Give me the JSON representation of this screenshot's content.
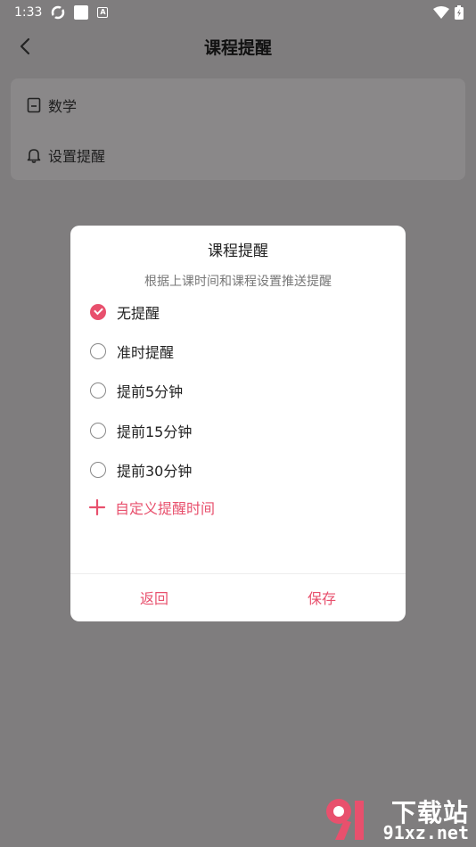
{
  "status_bar": {
    "time": "1:33",
    "a_label": "A",
    "icons": [
      "settings-sync-icon",
      "square-icon",
      "a-icon",
      "wifi-icon",
      "battery-icon"
    ]
  },
  "app_bar": {
    "title": "课程提醒"
  },
  "info_card": {
    "course_name": "数学",
    "reminder_label": "设置提醒"
  },
  "dialog": {
    "title": "课程提醒",
    "subtitle": "根据上课时间和课程设置推送提醒",
    "options": [
      {
        "label": "无提醒",
        "checked": true
      },
      {
        "label": "准时提醒",
        "checked": false
      },
      {
        "label": "提前5分钟",
        "checked": false
      },
      {
        "label": "提前15分钟",
        "checked": false
      },
      {
        "label": "提前30分钟",
        "checked": false
      }
    ],
    "custom_label": "自定义提醒时间",
    "back_label": "返回",
    "save_label": "保存"
  },
  "watermark": {
    "text": "下载站",
    "url": "91xz.net"
  },
  "colors": {
    "accent": "#e8506d",
    "overlay": "#7f7d7e"
  }
}
